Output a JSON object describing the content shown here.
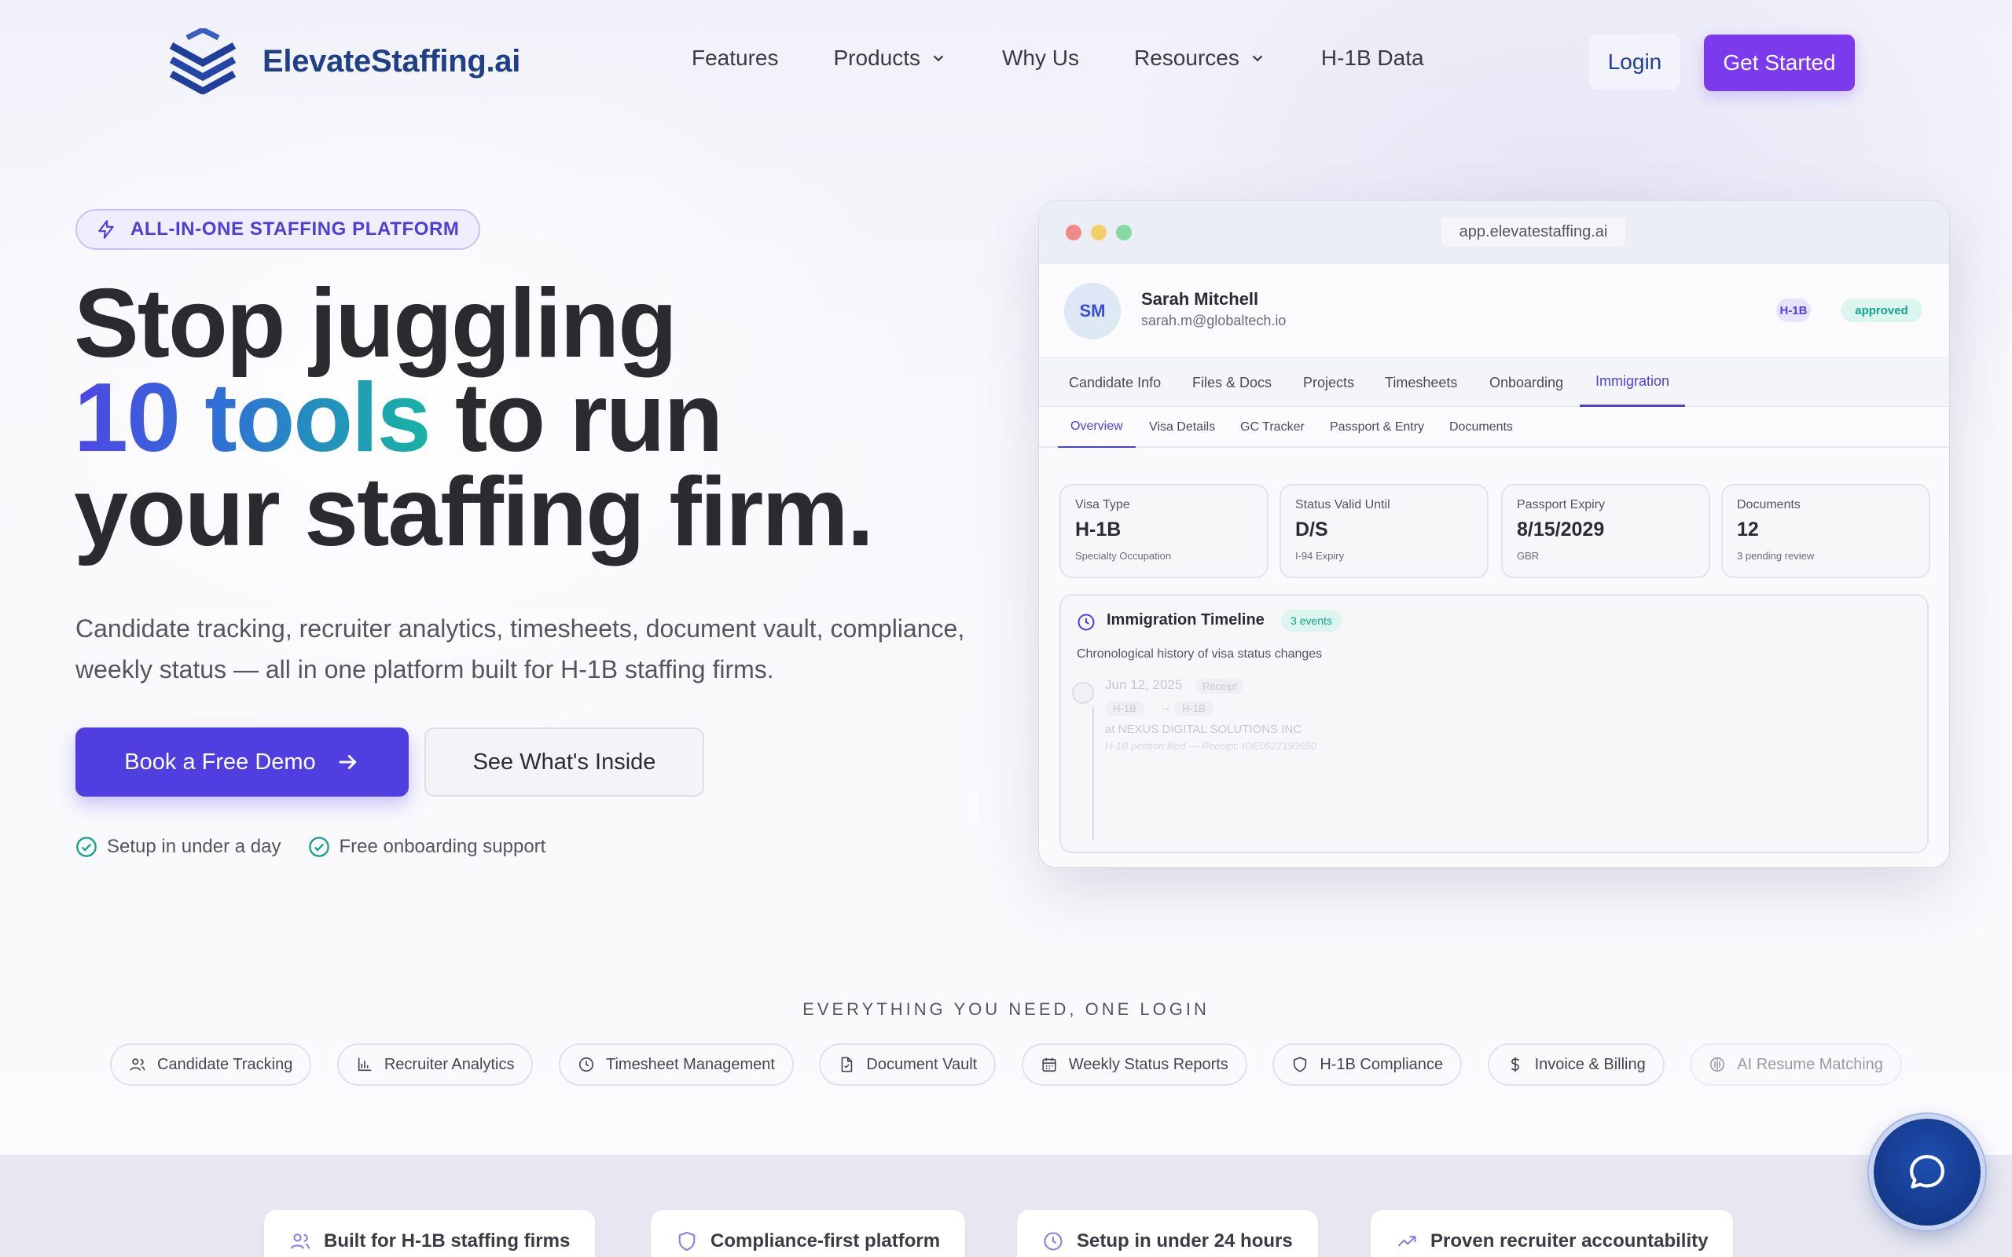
{
  "brand": {
    "name": "ElevateStaffing.ai",
    "logo_icon": "stacked-chevrons-logo",
    "color": "#1f3f86"
  },
  "nav": {
    "links": [
      {
        "label": "Features",
        "dropdown": false
      },
      {
        "label": "Products",
        "dropdown": true
      },
      {
        "label": "Why Us",
        "dropdown": false
      },
      {
        "label": "Resources",
        "dropdown": true
      },
      {
        "label": "H-1B Data",
        "dropdown": false
      }
    ],
    "login": "Login",
    "get_started": "Get Started"
  },
  "hero": {
    "pill": "ALL-IN-ONE STAFFING PLATFORM",
    "headline_line1": "Stop juggling",
    "headline_highlight": "10 tools",
    "headline_line2_rest": " to run",
    "headline_line3": "your staffing firm.",
    "subtitle": "Candidate tracking, recruiter analytics, timesheets, document vault, compliance, weekly status — all in one platform built for H-1B staffing firms.",
    "cta_primary": "Book a Free Demo",
    "cta_secondary": "See What's Inside",
    "checks": [
      "Setup in under a day",
      "Free onboarding support"
    ]
  },
  "mockup": {
    "url": "app.elevatestaffing.ai",
    "profile": {
      "initials": "SM",
      "name": "Sarah Mitchell",
      "email": "sarah.m@globaltech.io",
      "badges": [
        "H-1B",
        "approved"
      ]
    },
    "tabs": [
      "Candidate Info",
      "Files & Docs",
      "Projects",
      "Timesheets",
      "Onboarding",
      "Immigration"
    ],
    "active_tab": "Immigration",
    "subtabs": [
      "Overview",
      "Visa Details",
      "GC Tracker",
      "Passport & Entry",
      "Documents"
    ],
    "active_subtab": "Overview",
    "cards": [
      {
        "label": "Visa Type",
        "value": "H-1B",
        "sub": "Specialty Occupation"
      },
      {
        "label": "Status Valid Until",
        "value": "D/S",
        "sub": "I-94 Expiry"
      },
      {
        "label": "Passport Expiry",
        "value": "8/15/2029",
        "sub": "GBR"
      },
      {
        "label": "Documents",
        "value": "12",
        "sub": "3 pending review"
      }
    ],
    "timeline": {
      "title": "Immigration Timeline",
      "badge": "3 events",
      "description": "Chronological history of visa status changes",
      "event": {
        "date": "Jun 12, 2025",
        "tag": "Receipt",
        "from": "H-1B",
        "arrow": "→",
        "to": "H-1B",
        "company": "at NEXUS DIGITAL SOLUTIONS INC",
        "note": "H-1B petition filed — Receipt: IOE0927193650"
      }
    }
  },
  "features": {
    "title": "EVERYTHING YOU NEED, ONE LOGIN",
    "chips": [
      {
        "label": "Candidate Tracking",
        "icon": "users-icon"
      },
      {
        "label": "Recruiter Analytics",
        "icon": "bar-chart-icon"
      },
      {
        "label": "Timesheet Management",
        "icon": "clock-icon"
      },
      {
        "label": "Document Vault",
        "icon": "file-icon"
      },
      {
        "label": "Weekly Status Reports",
        "icon": "calendar-icon"
      },
      {
        "label": "H-1B Compliance",
        "icon": "shield-icon"
      },
      {
        "label": "Invoice & Billing",
        "icon": "dollar-icon"
      },
      {
        "label": "AI Resume Matching",
        "icon": "brain-icon"
      }
    ]
  },
  "band": {
    "items": [
      {
        "label": "Built for H-1B staffing firms",
        "icon": "users-icon"
      },
      {
        "label": "Compliance-first platform",
        "icon": "shield-icon"
      },
      {
        "label": "Setup in under 24 hours",
        "icon": "clock-icon"
      },
      {
        "label": "Proven recruiter accountability",
        "icon": "trending-up-icon"
      }
    ]
  },
  "colors": {
    "accent": "#4f3ee0",
    "cta": "#7c3aed",
    "teal": "#14a38a"
  }
}
